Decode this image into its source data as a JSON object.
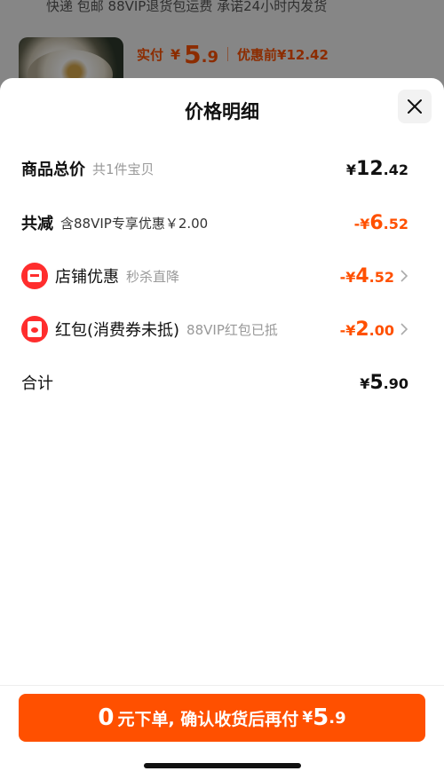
{
  "background": {
    "shipping_text": "快递 包邮 88VIP退货包运费 承诺24小时内发货",
    "paid_label": "实付",
    "paid_yen": "¥",
    "paid_int": "5",
    "paid_dec": ".9",
    "original_price": "优惠前¥12.42"
  },
  "sheet": {
    "title": "价格明细",
    "close_icon": "close-icon"
  },
  "rows": {
    "total": {
      "label": "商品总价",
      "sub": "共1件宝贝",
      "yen": "¥",
      "int": "12",
      "dec": ".42"
    },
    "reduce": {
      "label": "共减",
      "sub": "含88VIP专享优惠￥2.00",
      "yen": "-¥",
      "int": "6",
      "dec": ".52"
    },
    "shop": {
      "icon": "coupon-icon",
      "label": "店铺优惠",
      "sub": "秒杀直降",
      "yen": "-¥",
      "int": "4",
      "dec": ".52"
    },
    "redpack": {
      "icon": "red-envelope-icon",
      "label": "红包(消费券未抵)",
      "sub": "88VIP红包已抵",
      "yen": "-¥",
      "int": "2",
      "dec": ".00"
    },
    "sum": {
      "label": "合计",
      "yen": "¥",
      "int": "5",
      "dec": ".90"
    }
  },
  "cta": {
    "zero": "0",
    "text": "元下单, 确认收货后再付",
    "yen": "¥",
    "price_int": "5",
    "price_dec": ".9"
  },
  "colors": {
    "accent": "#ff5000",
    "icon_red": "#ff2d2d"
  }
}
